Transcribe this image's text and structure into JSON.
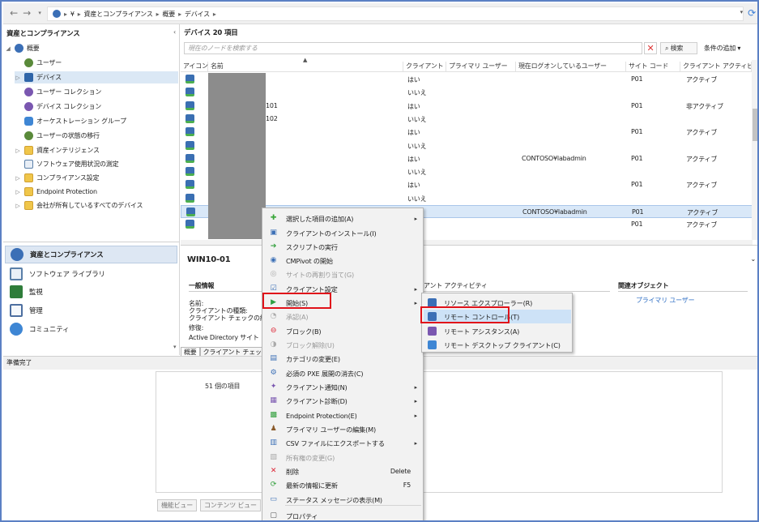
{
  "address_bar": {
    "back": "←",
    "forward": "→",
    "crumbs": [
      "¥",
      "資産とコンプライアンス",
      "概要",
      "デバイス"
    ],
    "refresh": "⟳"
  },
  "left_panel": {
    "title": "資産とコンプライアンス",
    "items": [
      {
        "label": "概要",
        "icon": "overview-icon"
      },
      {
        "label": "ユーザー",
        "icon": "user-icon"
      },
      {
        "label": "デバイス",
        "icon": "device-icon"
      },
      {
        "label": "ユーザー コレクション",
        "icon": "user-collection-icon"
      },
      {
        "label": "デバイス コレクション",
        "icon": "device-collection-icon"
      },
      {
        "label": "オーケストレーション グループ",
        "icon": "orchestration-icon"
      },
      {
        "label": "ユーザーの状態の移行",
        "icon": "migration-icon"
      },
      {
        "label": "資産インテリジェンス",
        "icon": "folder-icon"
      },
      {
        "label": "ソフトウェア使用状況の測定",
        "icon": "software-metering-icon"
      },
      {
        "label": "コンプライアンス設定",
        "icon": "folder-icon"
      },
      {
        "label": "Endpoint Protection",
        "icon": "folder-icon"
      },
      {
        "label": "会社が所有しているすべてのデバイス",
        "icon": "folder-icon"
      }
    ]
  },
  "workspaces": [
    {
      "label": "資産とコンプライアンス",
      "color": "#3b6fb6"
    },
    {
      "label": "ソフトウェア ライブラリ",
      "color": "#5a7fa8"
    },
    {
      "label": "監視",
      "color": "#2f7d3a"
    },
    {
      "label": "管理",
      "color": "#4d6fa0"
    },
    {
      "label": "コミュニティ",
      "color": "#3e86d4"
    }
  ],
  "status": "準備完了",
  "main": {
    "title": "デバイス 20 項目",
    "search_placeholder": "現在のノードを検索する",
    "search_button": "検索",
    "add_condition": "条件の追加 ▾",
    "columns": [
      "アイコン",
      "名前",
      "クライアント",
      "プライマリ ユーザー",
      "現在ログオンしているユーザー",
      "サイト コード",
      "クライアント アクティビティ"
    ],
    "rows": [
      {
        "name": "",
        "client": "はい",
        "logon": "",
        "site": "P01",
        "activity": "アクティブ"
      },
      {
        "name": "",
        "client": "いいえ",
        "logon": "",
        "site": "",
        "activity": ""
      },
      {
        "name": "101",
        "client": "はい",
        "logon": "",
        "site": "P01",
        "activity": "非アクティブ"
      },
      {
        "name": "102",
        "client": "いいえ",
        "logon": "",
        "site": "",
        "activity": ""
      },
      {
        "name": "",
        "client": "はい",
        "logon": "",
        "site": "P01",
        "activity": "アクティブ"
      },
      {
        "name": "",
        "client": "いいえ",
        "logon": "",
        "site": "",
        "activity": ""
      },
      {
        "name": "",
        "client": "はい",
        "logon": "CONTOSO¥labadmin",
        "site": "P01",
        "activity": "アクティブ"
      },
      {
        "name": "",
        "client": "いいえ",
        "logon": "",
        "site": "",
        "activity": ""
      },
      {
        "name": "",
        "client": "はい",
        "logon": "",
        "site": "P01",
        "activity": "アクティブ"
      },
      {
        "name": "",
        "client": "いいえ",
        "logon": "",
        "site": "",
        "activity": ""
      },
      {
        "name": "",
        "client": "",
        "logon": "CONTOSO¥labadmin",
        "site": "P01",
        "activity": "アクティブ"
      },
      {
        "name": "",
        "client": "",
        "logon": "",
        "site": "P01",
        "activity": "アクティブ"
      }
    ]
  },
  "details": {
    "title": "WIN10-01",
    "section_general": "一般情報",
    "section_activity": "アント アクティビティ",
    "section_related": "関連オブジェクト",
    "primary_user_link": "プライマリ ユーザー",
    "fields": [
      "名前:",
      "クライアントの種類:",
      "クライアント チェックの結",
      "修復:",
      "Active Directory サイト"
    ],
    "tabs": [
      "概要",
      "クライアント チェックの"
    ]
  },
  "bottom": {
    "count": "51 個の項目",
    "tabs": [
      "機能ビュー",
      "コンテンツ ビュー"
    ]
  },
  "context_menu": [
    {
      "label": "選択した項目の追加(A)",
      "submenu": true,
      "disabled": false,
      "icon": "add-icon"
    },
    {
      "label": "クライアントのインストール(I)",
      "disabled": false,
      "icon": "install-icon"
    },
    {
      "label": "スクリプトの実行",
      "disabled": false,
      "icon": "script-icon"
    },
    {
      "label": "CMPivot の開始",
      "disabled": false,
      "icon": "cmpivot-icon"
    },
    {
      "label": "サイトの再割り当て(G)",
      "disabled": true,
      "icon": "reassign-icon"
    },
    {
      "label": "クライアント設定",
      "submenu": true,
      "disabled": false,
      "icon": "settings-icon"
    },
    {
      "label": "開始(S)",
      "submenu": true,
      "disabled": false,
      "icon": "start-icon"
    },
    {
      "label": "承認(A)",
      "disabled": true,
      "icon": "approve-icon"
    },
    {
      "label": "ブロック(B)",
      "disabled": false,
      "icon": "block-icon"
    },
    {
      "label": "ブロック解除(U)",
      "disabled": true,
      "icon": "unblock-icon"
    },
    {
      "label": "カテゴリの変更(E)",
      "disabled": false,
      "icon": "category-icon"
    },
    {
      "label": "必須の PXE 展開の消去(C)",
      "disabled": false,
      "icon": "pxe-icon"
    },
    {
      "label": "クライアント通知(N)",
      "submenu": true,
      "disabled": false,
      "icon": "notify-icon"
    },
    {
      "label": "クライアント診断(D)",
      "submenu": true,
      "disabled": false,
      "icon": "diagnose-icon"
    },
    {
      "label": "Endpoint Protection(E)",
      "submenu": true,
      "disabled": false,
      "icon": "endpoint-icon"
    },
    {
      "label": "プライマリ ユーザーの編集(M)",
      "disabled": false,
      "icon": "edit-user-icon"
    },
    {
      "label": "CSV ファイルにエクスポートする",
      "submenu": true,
      "disabled": false,
      "icon": "csv-icon"
    },
    {
      "label": "所有権の変更(G)",
      "disabled": true,
      "icon": "ownership-icon"
    },
    {
      "label": "削除",
      "shortcut": "Delete",
      "disabled": false,
      "icon": "delete-icon"
    },
    {
      "label": "最新の情報に更新",
      "shortcut": "F5",
      "disabled": false,
      "icon": "refresh-icon"
    },
    {
      "label": "ステータス メッセージの表示(M)",
      "disabled": false,
      "icon": "status-icon"
    },
    {
      "label": "プロパティ",
      "disabled": false,
      "icon": "properties-icon"
    }
  ],
  "submenu": [
    {
      "label": "リソース エクスプローラー(R)",
      "icon": "resource-explorer-icon"
    },
    {
      "label": "リモート コントロール(T)",
      "icon": "remote-control-icon",
      "highlighted": true
    },
    {
      "label": "リモート アシスタンス(A)",
      "icon": "remote-assistance-icon"
    },
    {
      "label": "リモート デスクトップ クライアント(C)",
      "icon": "remote-desktop-icon"
    }
  ],
  "highlight_color": "#e0121a"
}
